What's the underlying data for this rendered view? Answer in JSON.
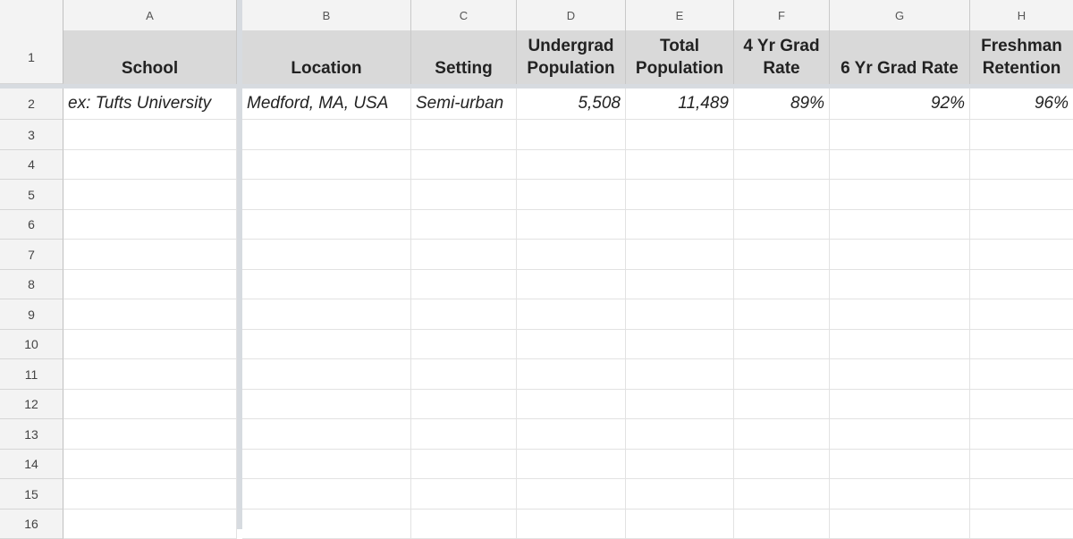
{
  "columns": [
    "A",
    "B",
    "C",
    "D",
    "E",
    "F",
    "G",
    "H"
  ],
  "rows": [
    "1",
    "2",
    "3",
    "4",
    "5",
    "6",
    "7",
    "8",
    "9",
    "10",
    "11",
    "12",
    "13",
    "14",
    "15",
    "16"
  ],
  "header_cells": {
    "A": "School",
    "B": "Location",
    "C": "Setting",
    "D_line1": "Undergrad",
    "D_line2": "Population",
    "E_line1": "Total",
    "E_line2": "Population",
    "F_line1": "4 Yr Grad",
    "F_line2": "Rate",
    "G": "6 Yr Grad Rate",
    "H_line1": "Freshman",
    "H_line2": "Retention"
  },
  "example_row": {
    "school": "ex: Tufts University",
    "location": "Medford, MA, USA",
    "setting": "Semi-urban",
    "undergrad_population": "5,508",
    "total_population": "11,489",
    "grad_rate_4yr": "89%",
    "grad_rate_6yr": "92%",
    "freshman_retention": "96%"
  }
}
